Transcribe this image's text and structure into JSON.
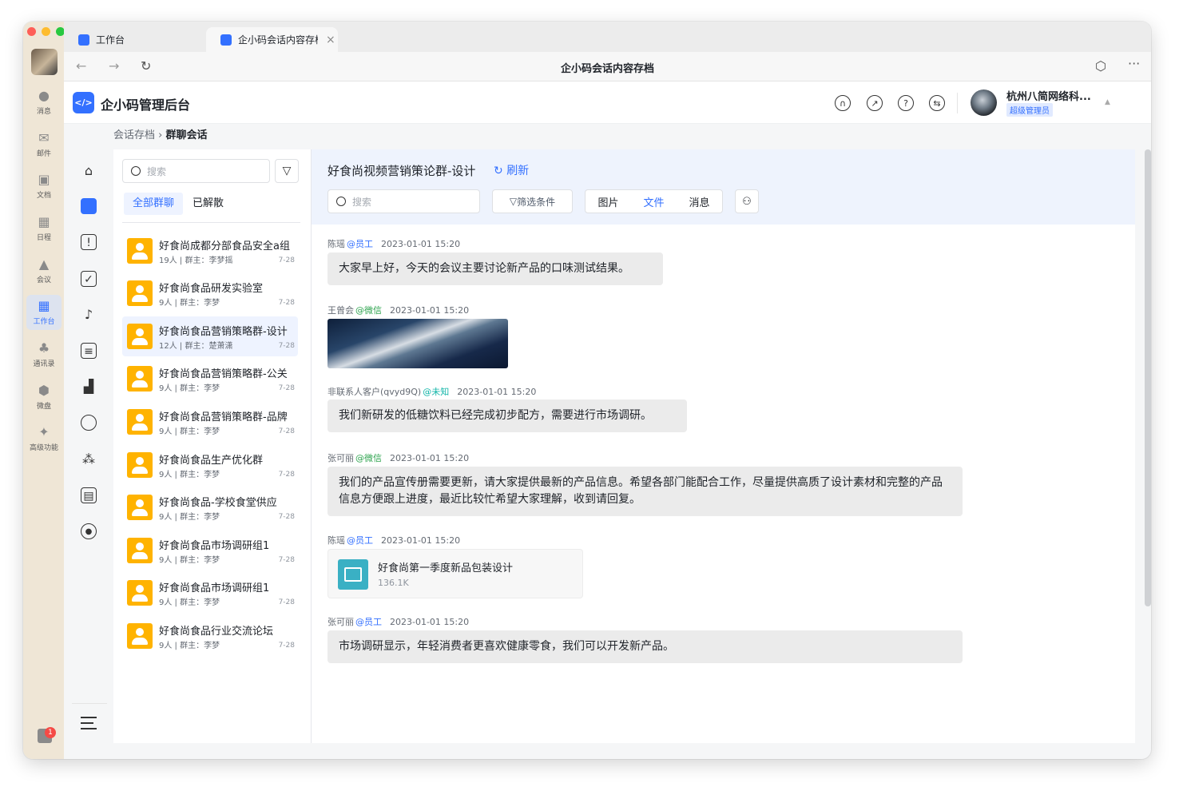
{
  "colors": {
    "accent": "#3370ff",
    "group_avatar": "#ffb300",
    "bubble": "#ebebeb",
    "rail": "#efe6d6",
    "chat_header": "#eef3fd"
  },
  "window": {
    "title": "企小码会话内容存档"
  },
  "tabs": [
    {
      "label": "工作台",
      "icon": "grid-icon"
    },
    {
      "label": "企小码会话内容存档",
      "icon": "app-icon"
    }
  ],
  "left_nav": {
    "items": [
      {
        "label": "消息",
        "icon": "chat-icon"
      },
      {
        "label": "邮件",
        "icon": "mail-icon"
      },
      {
        "label": "文档",
        "icon": "doc-icon"
      },
      {
        "label": "日程",
        "icon": "calendar-icon"
      },
      {
        "label": "会议",
        "icon": "meeting-icon"
      },
      {
        "label": "工作台",
        "icon": "grid-icon"
      },
      {
        "label": "通讯录",
        "icon": "contacts-icon"
      },
      {
        "label": "微盘",
        "icon": "drive-icon"
      },
      {
        "label": "高级功能",
        "icon": "star-icon"
      }
    ],
    "gift_badge": "1"
  },
  "app": {
    "title": "企小码管理后台",
    "logo_text": "</>",
    "user_name": "杭州八简网络科...",
    "user_role": "超级管理员"
  },
  "breadcrumb": {
    "root": "会话存档",
    "current": "群聊会话"
  },
  "group_list": {
    "search_placeholder": "搜索",
    "tabs": [
      "全部群聊",
      "已解散"
    ],
    "items": [
      {
        "name": "好食尚成都分部食品安全a组",
        "meta": "19人 | 群主：李梦摇",
        "date": "7-28"
      },
      {
        "name": "好食尚食品研发实验室",
        "meta": "9人 | 群主：李梦",
        "date": "7-28"
      },
      {
        "name": "好食尚食品营销策略群-设计",
        "meta": "12人 | 群主：楚萧潇",
        "date": "7-28"
      },
      {
        "name": "好食尚食品营销策略群-公关",
        "meta": "9人 | 群主：李梦",
        "date": "7-28"
      },
      {
        "name": "好食尚食品营销策略群-品牌",
        "meta": "9人 | 群主：李梦",
        "date": "7-28"
      },
      {
        "name": "好食尚食品生产优化群",
        "meta": "9人 | 群主：李梦",
        "date": "7-28"
      },
      {
        "name": "好食尚食品-学校食堂供应",
        "meta": "9人 | 群主：李梦",
        "date": "7-28"
      },
      {
        "name": "好食尚食品市场调研组1",
        "meta": "9人 | 群主：李梦",
        "date": "7-28"
      },
      {
        "name": "好食尚食品市场调研组1",
        "meta": "9人 | 群主：李梦",
        "date": "7-28"
      },
      {
        "name": "好食尚食品行业交流论坛",
        "meta": "9人 | 群主：李梦",
        "date": "7-28"
      }
    ]
  },
  "chat": {
    "title": "好食尚视频营销策论群-设计",
    "refresh": "刷新",
    "search_placeholder": "搜索",
    "filter_label": "筛选条件",
    "segments": [
      "图片",
      "文件",
      "消息"
    ],
    "messages": [
      {
        "sender": "陈瑶",
        "tag": "@员工",
        "time": "2023-01-01 15:20",
        "text": "大家早上好，今天的会议主要讨论新产品的口味测试结果。"
      },
      {
        "sender": "王曾会",
        "tag": "@微信",
        "time": "2023-01-01 15:20"
      },
      {
        "sender": "非联系人客户(qvyd9Q)",
        "tag": "@未知",
        "time": "2023-01-01 15:20",
        "text": "我们新研发的低糖饮料已经完成初步配方，需要进行市场调研。"
      },
      {
        "sender": "张可丽",
        "tag": "@微信",
        "time": "2023-01-01 15:20",
        "text": "我们的产品宣传册需要更新，请大家提供最新的产品信息。希望各部门能配合工作，尽量提供高质了设计素材和完整的产品信息方便跟上进度，最近比较忙希望大家理解，收到请回复。"
      },
      {
        "sender": "陈瑶",
        "tag": "@员工",
        "time": "2023-01-01 15:20",
        "file_name": "好食尚第一季度新品包装设计",
        "file_size": "136.1K"
      },
      {
        "sender": "张可丽",
        "tag": "@员工",
        "time": "2023-01-01 15:20",
        "text": "市场调研显示，年轻消费者更喜欢健康零食，我们可以开发新产品。"
      }
    ]
  }
}
